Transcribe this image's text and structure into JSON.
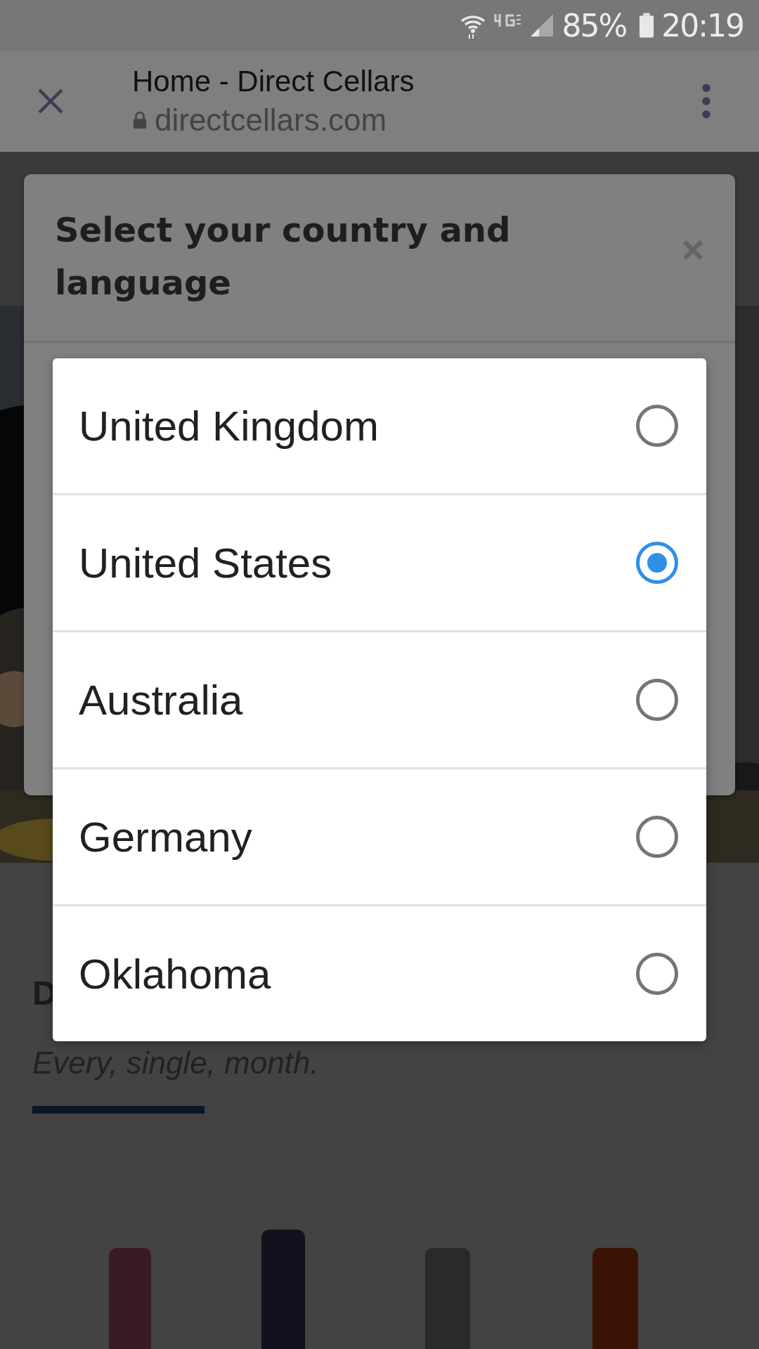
{
  "status_bar": {
    "battery": "85%",
    "time": "20:19"
  },
  "browser": {
    "title": "Home - Direct Cellars",
    "url": "directcellars.com"
  },
  "page": {
    "heading": "D",
    "tagline": "Every, single, month."
  },
  "modal": {
    "title": "Select your country and language"
  },
  "options": [
    {
      "label": "United Kingdom",
      "selected": false
    },
    {
      "label": "United States",
      "selected": true
    },
    {
      "label": "Australia",
      "selected": false
    },
    {
      "label": "Germany",
      "selected": false
    },
    {
      "label": "Oklahoma",
      "selected": false
    }
  ]
}
